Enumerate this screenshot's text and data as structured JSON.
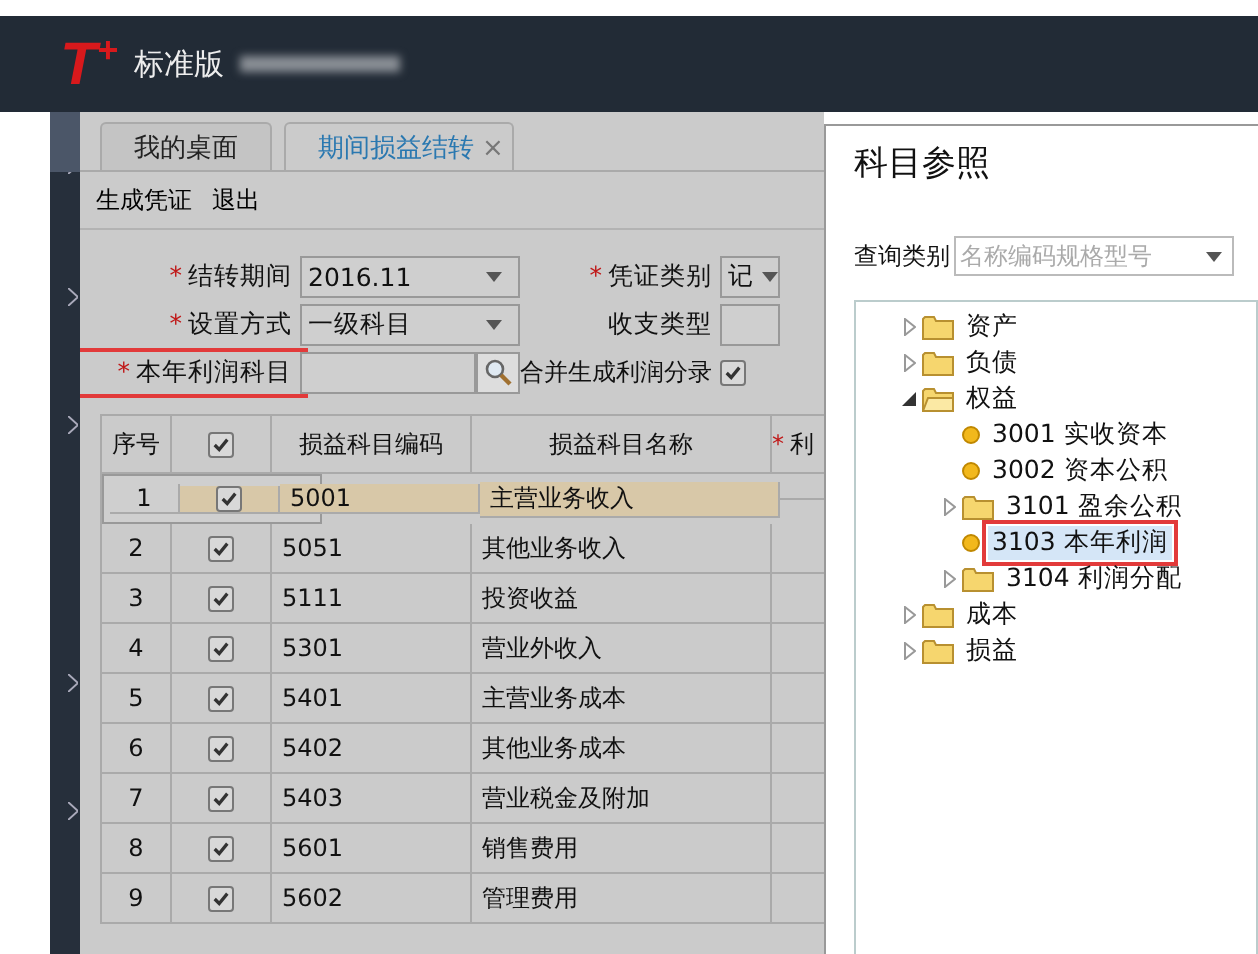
{
  "header": {
    "logo": "T",
    "logo_sup": "+",
    "edition": "标准版"
  },
  "tabs": [
    {
      "label": "我的桌面",
      "selected": false
    },
    {
      "label": "期间损益结转",
      "selected": true,
      "close": "×"
    }
  ],
  "toolbar": [
    "生成凭证",
    "退出"
  ],
  "required_mark": "*",
  "form": [
    {
      "label": "结转期间",
      "required": true,
      "kind": "select",
      "value": "2016.11"
    },
    {
      "label": "凭证类别",
      "required": true,
      "kind": "select",
      "value": "记"
    },
    {
      "label": "设置方式",
      "required": true,
      "kind": "select",
      "value": "一级科目"
    },
    {
      "label": "收支类型",
      "required": false,
      "kind": "text"
    },
    {
      "label": "本年利润科目",
      "required": true,
      "kind": "lookup",
      "annotated": true
    },
    {
      "label": "合并生成利润分录",
      "required": false,
      "kind": "checkbox",
      "checked": true
    }
  ],
  "table": {
    "columns": [
      {
        "label": "序号",
        "required": false
      },
      {
        "label": "损益科目编码",
        "required": false
      },
      {
        "label": "损益科目名称",
        "required": false
      },
      {
        "label": "利",
        "required": true
      }
    ],
    "header_checked": true,
    "rows": [
      {
        "no": "1",
        "checked": true,
        "code": "5001",
        "name": "主营业务收入",
        "selected": true
      },
      {
        "no": "2",
        "checked": true,
        "code": "5051",
        "name": "其他业务收入",
        "selected": false
      },
      {
        "no": "3",
        "checked": true,
        "code": "5111",
        "name": "投资收益",
        "selected": false
      },
      {
        "no": "4",
        "checked": true,
        "code": "5301",
        "name": "营业外收入",
        "selected": false
      },
      {
        "no": "5",
        "checked": true,
        "code": "5401",
        "name": "主营业务成本",
        "selected": false
      },
      {
        "no": "6",
        "checked": true,
        "code": "5402",
        "name": "其他业务成本",
        "selected": false
      },
      {
        "no": "7",
        "checked": true,
        "code": "5403",
        "name": "营业税金及附加",
        "selected": false
      },
      {
        "no": "8",
        "checked": true,
        "code": "5601",
        "name": "销售费用",
        "selected": false
      },
      {
        "no": "9",
        "checked": true,
        "code": "5602",
        "name": "管理费用",
        "selected": false
      }
    ]
  },
  "dialog": {
    "title": "科目参照",
    "query_label": "查询类别",
    "query_placeholder": "名称编码规格型号",
    "tree": [
      {
        "label": "资产",
        "kind": "folder",
        "expanded": false,
        "selected": false
      },
      {
        "label": "负债",
        "kind": "folder",
        "expanded": false,
        "selected": false
      },
      {
        "label": "权益",
        "kind": "folder",
        "expanded": true,
        "selected": false,
        "children": [
          {
            "label": "3001 实收资本",
            "kind": "leaf",
            "selected": false
          },
          {
            "label": "3002 资本公积",
            "kind": "leaf",
            "selected": false
          },
          {
            "label": "3101 盈余公积",
            "kind": "folder",
            "expanded": false,
            "selected": false
          },
          {
            "label": "3103 本年利润",
            "kind": "leaf",
            "selected": true,
            "annotated": true
          },
          {
            "label": "3104 利润分配",
            "kind": "folder",
            "expanded": false,
            "selected": false
          }
        ]
      },
      {
        "label": "成本",
        "kind": "folder",
        "expanded": false,
        "selected": false
      },
      {
        "label": "损益",
        "kind": "folder",
        "expanded": false,
        "selected": false
      }
    ]
  }
}
